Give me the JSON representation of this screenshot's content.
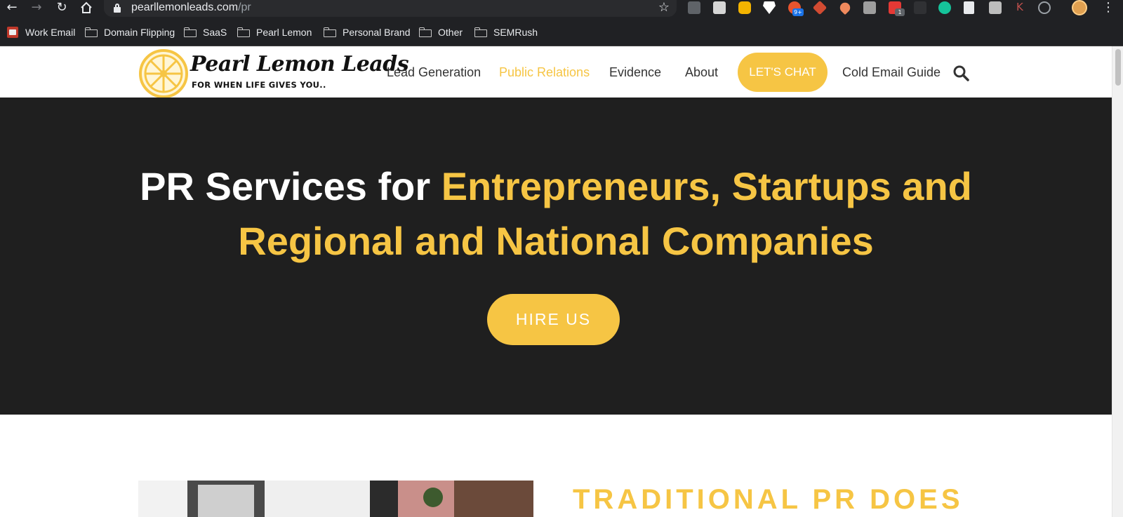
{
  "browser": {
    "url_host": "pearllemonleads.com",
    "url_path": "/pr",
    "bookmarks": [
      "Work Email",
      "Domain Flipping",
      "SaaS",
      "Pearl Lemon",
      "Personal Brand",
      "Other",
      "SEMRush"
    ],
    "extension_badges": {
      "notifications": "9+",
      "count": "1"
    },
    "extension_letter": "K"
  },
  "site": {
    "logo_name": "Pearl Lemon Leads",
    "logo_tagline": "FOR WHEN LIFE GIVES YOU..",
    "nav": [
      "Lead Generation",
      "Public Relations",
      "Evidence",
      "About",
      "LET'S CHAT",
      "Cold Email Guide"
    ],
    "active_nav": "Public Relations"
  },
  "hero": {
    "title_white": "PR Services for ",
    "title_yellow_1": "Entrepreneurs, Startups and",
    "title_yellow_2": "Regional and National Companies",
    "cta": "HIRE US"
  },
  "section": {
    "heading": "TRADITIONAL PR DOES"
  },
  "colors": {
    "accent": "#f6c544",
    "hero_bg": "#1f1f1f",
    "chrome_bg": "#202124"
  }
}
